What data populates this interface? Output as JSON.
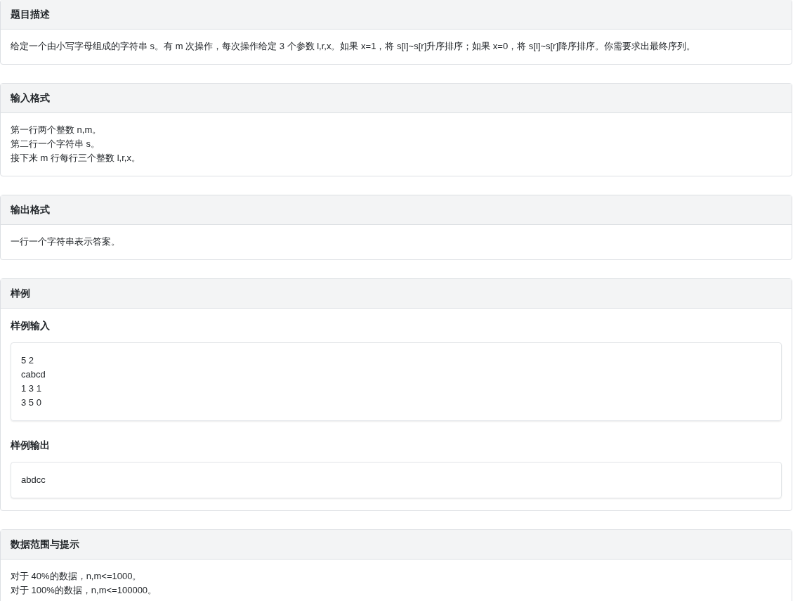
{
  "sections": [
    {
      "title": "题目描述",
      "kind": "text",
      "lines": [
        "给定一个由小写字母组成的字符串 s。有 m 次操作，每次操作给定 3 个参数 l,r,x。如果 x=1，将 s[l]~s[r]升序排序；如果 x=0，将 s[l]~s[r]降序排序。你需要求出最终序列。"
      ]
    },
    {
      "title": "输入格式",
      "kind": "text",
      "lines": [
        "第一行两个整数 n,m。",
        "第二行一个字符串 s。",
        "接下来 m 行每行三个整数 l,r,x。"
      ]
    },
    {
      "title": "输出格式",
      "kind": "text",
      "lines": [
        "一行一个字符串表示答案。"
      ]
    },
    {
      "title": "样例",
      "kind": "samples",
      "samples": [
        {
          "label": "样例输入",
          "lines": [
            "5 2",
            "cabcd",
            "1 3 1",
            "3 5 0"
          ]
        },
        {
          "label": "样例输出",
          "lines": [
            "abdcc"
          ]
        }
      ]
    },
    {
      "title": "数据范围与提示",
      "kind": "text",
      "lines": [
        "对于 40%的数据，n,m<=1000。",
        "对于 100%的数据，n,m<=100000。"
      ]
    }
  ]
}
